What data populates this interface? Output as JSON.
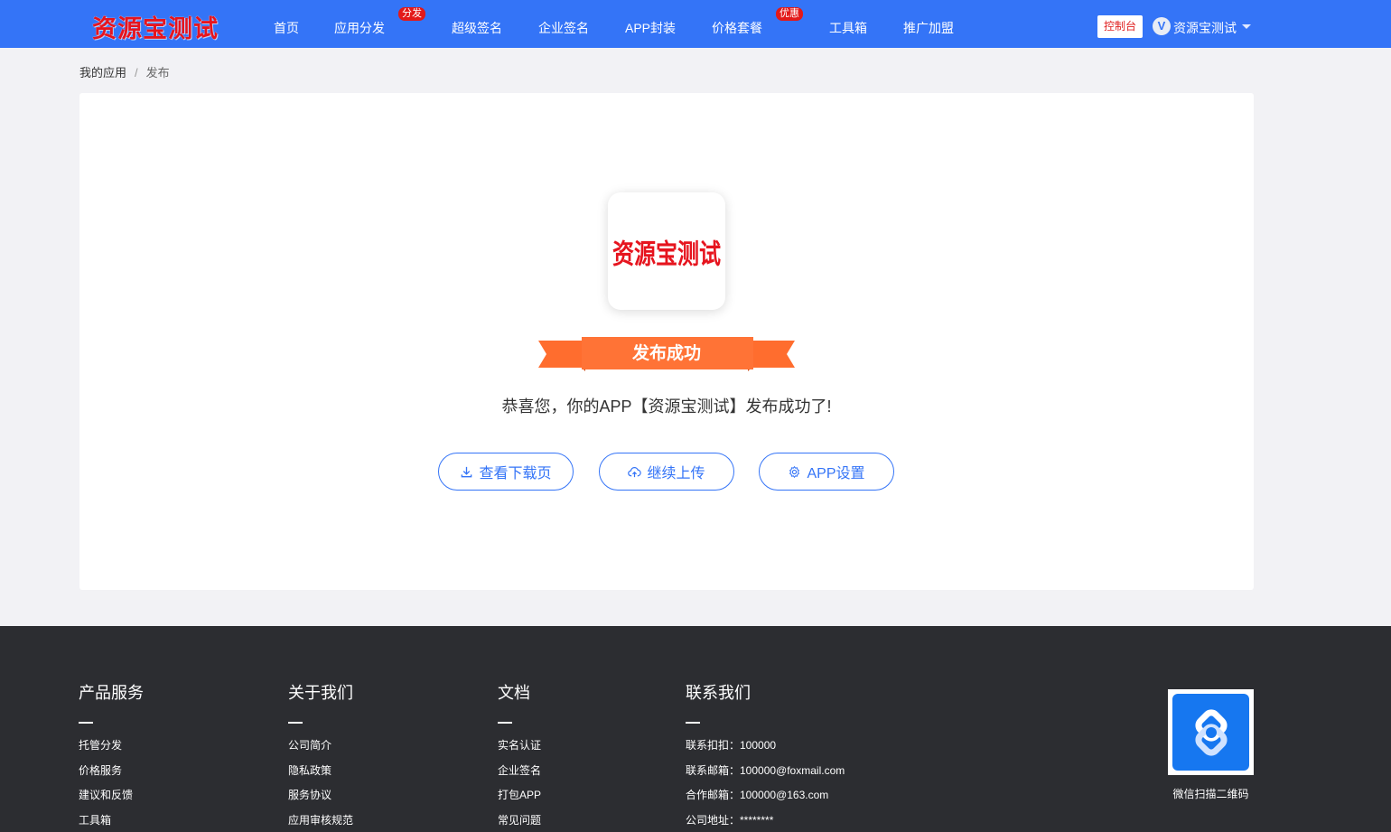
{
  "header": {
    "logo": "资源宝测试",
    "nav": [
      {
        "label": "首页"
      },
      {
        "label": "应用分发",
        "badge": "分发"
      },
      {
        "label": "超级签名"
      },
      {
        "label": "企业签名"
      },
      {
        "label": "APP封装"
      },
      {
        "label": "价格套餐",
        "badge": "优惠"
      },
      {
        "label": "工具箱"
      },
      {
        "label": "推广加盟"
      }
    ],
    "console_label": "控制台",
    "avatar_letter": "V",
    "user_name": "资源宝测试"
  },
  "breadcrumb": {
    "parent": "我的应用",
    "separator": "/",
    "current": "发布"
  },
  "main": {
    "app_icon_text": "资源宝测试",
    "ribbon_label": "发布成功",
    "message": "恭喜您，你的APP【资源宝测试】发布成功了!",
    "buttons": {
      "view_download": "查看下载页",
      "continue_upload": "继续上传",
      "app_settings": "APP设置"
    }
  },
  "footer": {
    "columns": [
      {
        "title": "产品服务",
        "items": [
          "托管分发",
          "价格服务",
          "建议和反馈",
          "工具箱"
        ]
      },
      {
        "title": "关于我们",
        "items": [
          "公司简介",
          "隐私政策",
          "服务协议",
          "应用审核规范"
        ]
      },
      {
        "title": "文档",
        "items": [
          "实名认证",
          "企业签名",
          "打包APP",
          "常见问题"
        ]
      },
      {
        "title": "联系我们",
        "items": [
          "联系扣扣：100000",
          "联系邮箱：100000@foxmail.com",
          "合作邮箱：100000@163.com",
          "公司地址：********"
        ]
      }
    ],
    "qr_caption": "微信扫描二维码"
  },
  "colors": {
    "header_bg": "#3474f7",
    "accent": "#3474f7",
    "logo_red": "#e6141e",
    "ribbon_orange": "#ff6d2e",
    "footer_bg": "#2c2d31"
  }
}
